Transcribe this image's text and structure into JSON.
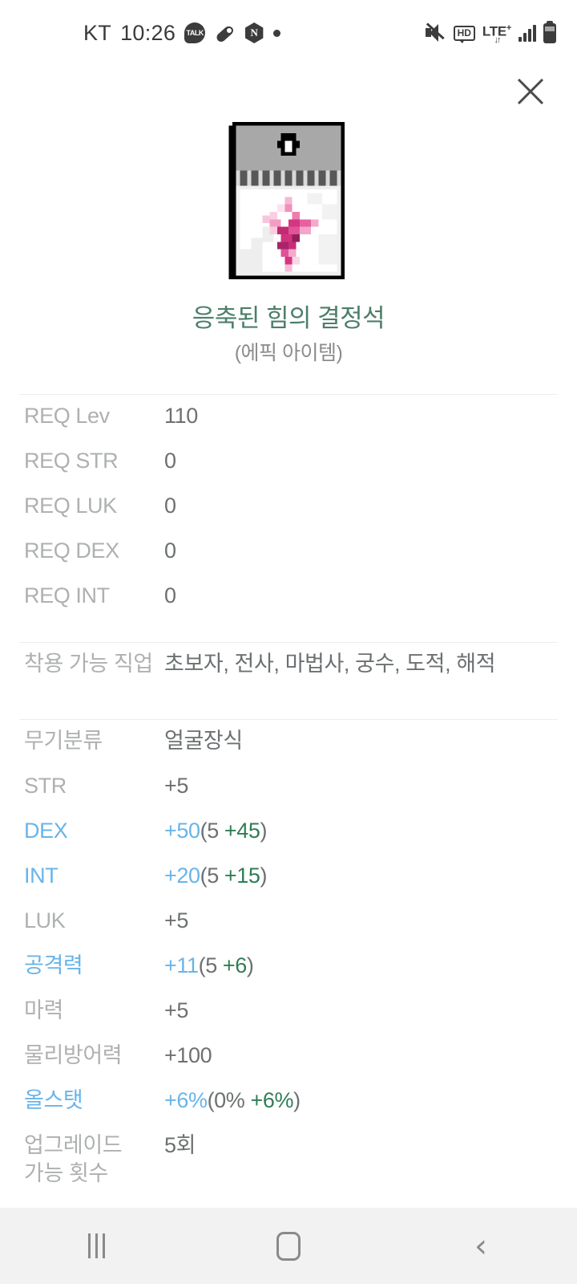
{
  "status_bar": {
    "carrier": "KT",
    "time": "10:26",
    "left_icons": [
      "kakaotalk-icon",
      "pill-icon",
      "naver-icon",
      "dot-icon"
    ],
    "right_icons": [
      "mute-icon",
      "hd-voice-icon",
      "lte-plus-icon",
      "signal-bars-icon",
      "battery-icon"
    ],
    "talk_label": "TALK",
    "naver_label": "N",
    "hd_label": "HD",
    "lte_label": "LTE",
    "lte_sup": "+",
    "lte_arrows": "↓↑"
  },
  "header": {
    "close_label": "×"
  },
  "item": {
    "name": "응축된 힘의 결정석",
    "grade": "(에픽 아이템)",
    "name_color": "#4c7f6a",
    "icon_name": "crystal-item-icon"
  },
  "requirements": [
    {
      "label": "REQ Lev",
      "value": "110"
    },
    {
      "label": "REQ STR",
      "value": "0"
    },
    {
      "label": "REQ LUK",
      "value": "0"
    },
    {
      "label": "REQ DEX",
      "value": "0"
    },
    {
      "label": "REQ INT",
      "value": "0"
    }
  ],
  "job": [
    {
      "label": "착용 가능 직업",
      "value": "초보자, 전사, 마법사, 궁수, 도적, 해적"
    }
  ],
  "stats": [
    {
      "label": "무기분류",
      "value": "얼굴장식",
      "highlight": false
    },
    {
      "label": "STR",
      "value": "+5",
      "highlight": false
    },
    {
      "label": "DEX",
      "main": "+50",
      "paren_open": "(5 ",
      "bonus": "+45",
      "paren_close": ")",
      "highlight": true
    },
    {
      "label": "INT",
      "main": "+20",
      "paren_open": "(5 ",
      "bonus": "+15",
      "paren_close": ")",
      "highlight": true
    },
    {
      "label": "LUK",
      "value": "+5",
      "highlight": false
    },
    {
      "label": "공격력",
      "main": "+11",
      "paren_open": "(5 ",
      "bonus": "+6",
      "paren_close": ")",
      "highlight": true
    },
    {
      "label": "마력",
      "value": "+5",
      "highlight": false
    },
    {
      "label": "물리방어력",
      "value": "+100",
      "highlight": false
    },
    {
      "label": "올스탯",
      "main": "+6%",
      "paren_open": "(0% ",
      "bonus": "+6%",
      "paren_close": ")",
      "highlight": true
    },
    {
      "label": "업그레이드\n가능 횟수",
      "value": "5회",
      "highlight": false,
      "two_line": true
    }
  ],
  "nav_bar": {
    "items": [
      "recents-button",
      "home-button",
      "back-button"
    ],
    "back_glyph": "‹"
  },
  "colors": {
    "label": "#aeb0b1",
    "value": "#6d7072",
    "highlight_blue": "#69b4e8",
    "bonus_green": "#2f7d55",
    "divider": "#eceded",
    "navbar_bg": "#f2f2f2"
  }
}
